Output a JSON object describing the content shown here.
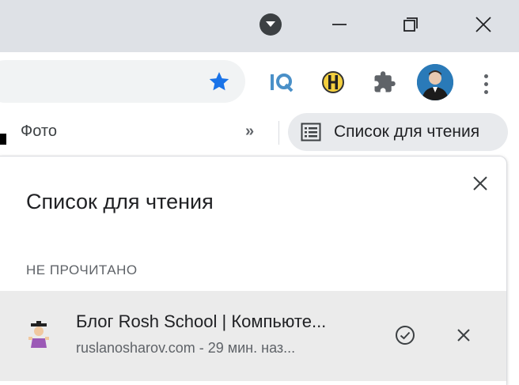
{
  "colors": {
    "titlebar_bg": "#dee1e6",
    "star": "#1a73e8",
    "item_bg": "#ebebeb",
    "reading_list_button_bg": "#e8eaed"
  },
  "titlebar": {
    "tab_search_icon": "chevron-down-circle",
    "minimize_icon": "minimize",
    "maximize_icon": "restore",
    "close_icon": "close"
  },
  "toolbar": {
    "bookmark_icon": "star-filled",
    "extensions": [
      {
        "name": "iq-extension-icon",
        "text": "IQ"
      },
      {
        "name": "h-extension-icon",
        "text": "H"
      },
      {
        "name": "puzzle-icon",
        "text": ""
      }
    ],
    "menu_icon": "vertical-dots"
  },
  "bookmarks_bar": {
    "items": [
      "Фото"
    ],
    "more_label": "»",
    "reading_list_label": "Список для чтения"
  },
  "reading_list_panel": {
    "title": "Список для чтения",
    "section_header": "НЕ ПРОЧИТАНО",
    "items": [
      {
        "title": "Блог Rosh School | Компьюте...",
        "subtitle": "ruslanosharov.com - 29 мин. наз..."
      }
    ]
  }
}
